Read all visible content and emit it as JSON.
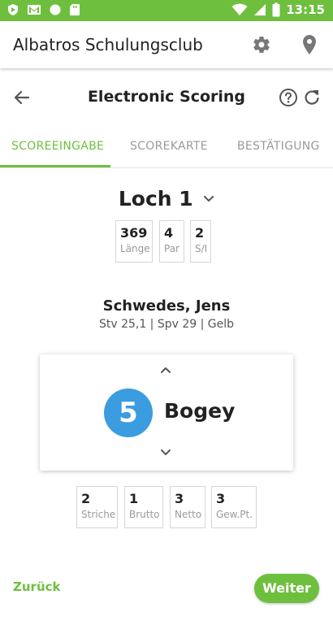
{
  "statusbar": {
    "time": "13:15",
    "left_icons": [
      "app-notification-icon",
      "gmail-icon",
      "circle-notification-icon",
      "sd-card-icon"
    ],
    "right_icons": [
      "wifi-icon",
      "signal-icon",
      "battery-icon"
    ]
  },
  "appbar": {
    "title": "Albatros Schulungsclub",
    "icons": [
      "gear-icon",
      "location-pin-icon"
    ]
  },
  "subheader": {
    "title": "Electronic Scoring",
    "icons": [
      "back-arrow-icon",
      "help-icon",
      "refresh-icon"
    ]
  },
  "tabs": [
    {
      "label": "SCOREEINGABE",
      "active": true
    },
    {
      "label": "SCOREKARTE",
      "active": false
    },
    {
      "label": "BESTÄTIGUNG",
      "active": false
    }
  ],
  "hole": {
    "name": "Loch 1",
    "stats": [
      {
        "value": "369",
        "label": "Länge"
      },
      {
        "value": "4",
        "label": "Par"
      },
      {
        "value": "2",
        "label": "S/I"
      }
    ]
  },
  "player": {
    "name": "Schwedes, Jens",
    "info": "Stv 25,1 | Spv 29 | Gelb"
  },
  "score": {
    "value": "5",
    "label": "Bogey"
  },
  "results": [
    {
      "value": "2",
      "label": "Striche"
    },
    {
      "value": "1",
      "label": "Brutto"
    },
    {
      "value": "3",
      "label": "Netto"
    },
    {
      "value": "3",
      "label": "Gew.Pt."
    }
  ],
  "footer": {
    "back_label": "Zurück",
    "next_label": "Weiter"
  },
  "colors": {
    "accent": "#6fbf3f",
    "score_circle": "#3b9de0"
  }
}
